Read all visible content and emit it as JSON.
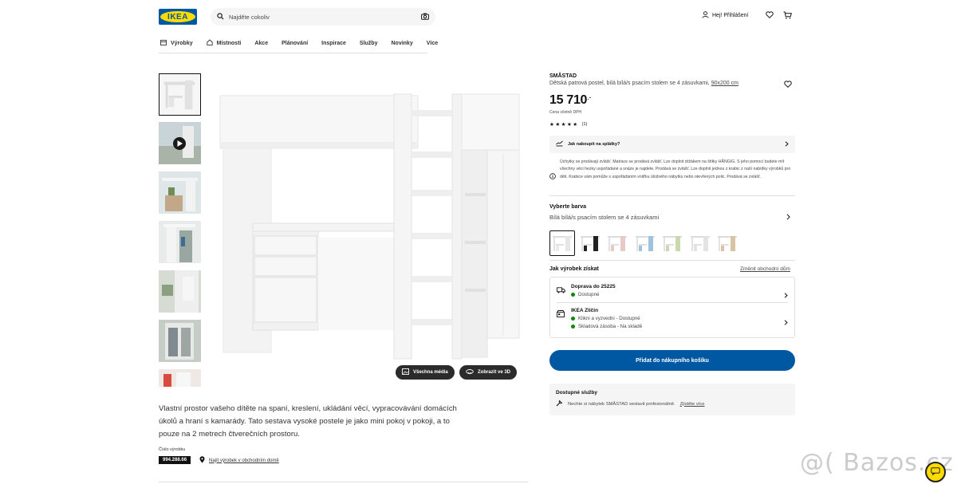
{
  "header": {
    "logo_text": "IKEA",
    "search_placeholder": "Najděte cokoliv",
    "login_label": "Hej! Přihlášení",
    "icons": [
      "search-icon",
      "camera-icon",
      "user-icon",
      "heart-icon",
      "cart-icon"
    ]
  },
  "nav": {
    "items": [
      {
        "label": "Výrobky",
        "icon": "catalog-icon"
      },
      {
        "label": "Místnosti",
        "icon": "home-icon"
      },
      {
        "label": "Akce"
      },
      {
        "label": "Plánování"
      },
      {
        "label": "Inspirace"
      },
      {
        "label": "Služby"
      },
      {
        "label": "Novinky"
      },
      {
        "label": "Více"
      }
    ]
  },
  "gallery": {
    "all_media_label": "Všechna média",
    "view_3d_label": "Zobrazit ve 3D"
  },
  "product": {
    "name": "SMÅSTAD",
    "description": "Dětská patrová postel, bílá bílá/s psacím stolem se 4 zásuvkami,",
    "size": "90x200 cm",
    "price": "15 710",
    "price_suffix": ".-",
    "vat_note": "Cena včetně DPH",
    "stars": "★★★★★",
    "review_count": "(1)",
    "installment_label": "Jak nakoupit na splátky?",
    "notice": "Úchytky se prodávají zvlášť. Matrace se prodává zvlášť. Lze doplnit držákem na štítky HÅNGIG. S jeho pomocí budete mít všechny věci hezky uspořádané a snáze je najdete. Prodává se zvlášť. Lze doplnit jednou z krabic z naší nabídky výrobků pro děti. Krabice vám pomůže s uspořádáním vnitřku úložného nábytku nebo otevřených polic. Prodává se zvlášť."
  },
  "color": {
    "title": "Vyberte barva",
    "value": "Bílá bílá/s psacím stolem se 4 zásuvkami",
    "swatch_accents": [
      "#ffffff",
      "#222222",
      "#e9c8c8",
      "#9ec3df",
      "#c8d9b0",
      "#e3e3e3",
      "#d8c3a5"
    ]
  },
  "delivery": {
    "title": "Jak výrobek získat",
    "change_store": "Změnit obchodní dům",
    "shipping_title": "Doprava do 25225",
    "shipping_status": "Dostupné",
    "store_title": "IKEA Zličín",
    "store_status_1": "Klikni a vyzvedni - Dostupné",
    "store_status_2": "Skladová zásoba - Na skladě",
    "status_color": "#0a8a00"
  },
  "cart": {
    "add_label": "Přidat do nákupního košíku",
    "accent": "#0058a3"
  },
  "services": {
    "title": "Dostupné služby",
    "text": "Nechte si nábytek SMÅSTAD sestavit profesionálně.",
    "link": "Zjistěte více"
  },
  "details": {
    "text": "Vlastní prostor vašeho dítěte na spaní, kreslení, ukládání věcí, vypracovávání domácích úkolů a hraní s kamarády. Tato sestava vysoké postele je jako mini pokoj v pokoji, a to pouze na 2 metrech čtverečních prostoru.",
    "article_label": "Číslo výrobku",
    "article_number": "994.288.66",
    "find_in_store": "Najít výrobek v obchodním domě"
  },
  "watermark": {
    "text": "@( Bazos.cz"
  }
}
